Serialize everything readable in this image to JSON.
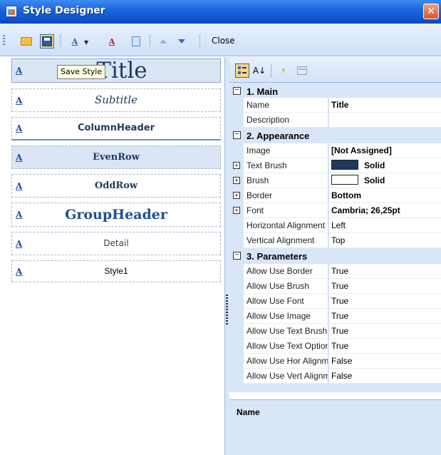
{
  "window": {
    "title": "Style Designer",
    "close_glyph": "✕"
  },
  "toolbar": {
    "close_label": "Close",
    "icons": [
      "open-folder-icon",
      "save-icon",
      "add-style-icon",
      "delete-style-icon",
      "copy-icon",
      "move-up-icon",
      "move-down-icon"
    ],
    "style_glyph": "A"
  },
  "tooltip": {
    "text": "Save Style"
  },
  "styles": [
    {
      "label": "Title"
    },
    {
      "label": "Subtitle"
    },
    {
      "label": "ColumnHeader"
    },
    {
      "label": "EvenRow"
    },
    {
      "label": "OddRow"
    },
    {
      "label": "GroupHeader"
    },
    {
      "label": "Detail"
    },
    {
      "label": "Style1"
    }
  ],
  "style_icon_glyph": "A",
  "grid_toolbar": {
    "sort_glyph": "A↓",
    "events_glyph": "⚡"
  },
  "grid": {
    "categories": {
      "main": "1. Main",
      "appearance": "2. Appearance",
      "parameters": "3. Parameters"
    },
    "main": [
      {
        "name": "Name",
        "value": "Title"
      },
      {
        "name": "Description",
        "value": ""
      }
    ],
    "appearance": [
      {
        "name": "Image",
        "value": "[Not Assigned]"
      },
      {
        "name": "Text Brush",
        "value": "Solid",
        "swatch": "#1f3a5f"
      },
      {
        "name": "Brush",
        "value": "Solid",
        "swatch": "#ffffff"
      },
      {
        "name": "Border",
        "value": "Bottom"
      },
      {
        "name": "Font",
        "value": "Cambria; 26,25pt"
      },
      {
        "name": "Horizontal Alignment",
        "value": "Left"
      },
      {
        "name": "Vertical Alignment",
        "value": "Top"
      }
    ],
    "parameters": [
      {
        "name": "Allow Use Border",
        "value": "True"
      },
      {
        "name": "Allow Use Brush",
        "value": "True"
      },
      {
        "name": "Allow Use Font",
        "value": "True"
      },
      {
        "name": "Allow Use Image",
        "value": "True"
      },
      {
        "name": "Allow Use Text Brush",
        "value": "True"
      },
      {
        "name": "Allow Use Text Options",
        "value": "True"
      },
      {
        "name": "Allow Use Hor Alignment",
        "value": "False"
      },
      {
        "name": "Allow Use Vert Alignment",
        "value": "False"
      }
    ]
  },
  "description": {
    "title": "Name"
  }
}
